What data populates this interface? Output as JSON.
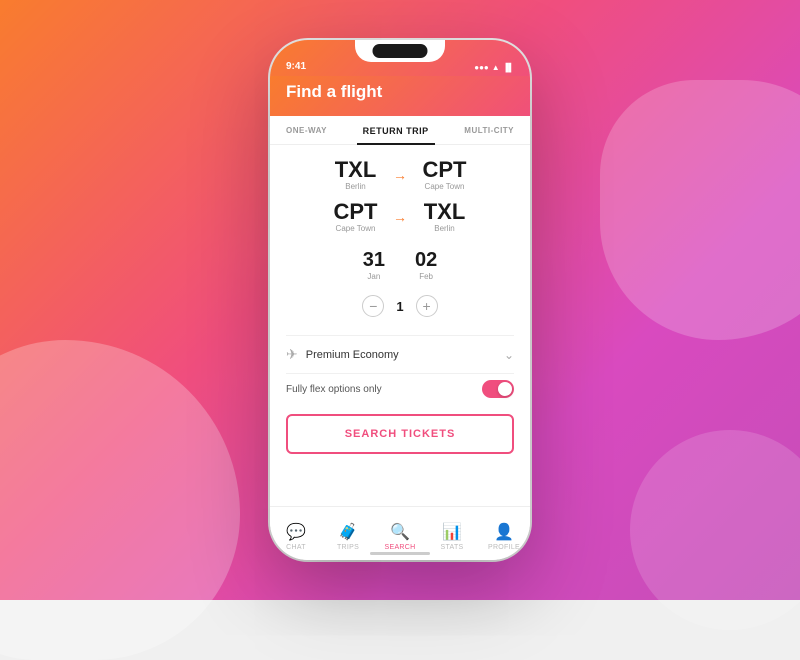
{
  "background": {
    "gradient_start": "#f97c2e",
    "gradient_end": "#c44db8"
  },
  "status_bar": {
    "time": "9:41",
    "signal": "▌▌▌",
    "wifi": "▲",
    "battery": "▐"
  },
  "header": {
    "title": "Find a flight"
  },
  "tabs": {
    "items": [
      {
        "label": "ONE-WAY",
        "active": false
      },
      {
        "label": "RETURN TRIP",
        "active": true
      },
      {
        "label": "MULTI-CITY",
        "active": false
      }
    ]
  },
  "routes": [
    {
      "from_code": "TXL",
      "from_city": "Berlin",
      "to_code": "CPT",
      "to_city": "Cape Town"
    },
    {
      "from_code": "CPT",
      "from_city": "Cape Town",
      "to_code": "TXL",
      "to_city": "Berlin"
    }
  ],
  "dates": {
    "depart_day": "31",
    "depart_month": "Jan",
    "return_day": "02",
    "return_month": "Feb"
  },
  "passengers": {
    "count": "1",
    "minus_label": "−",
    "plus_label": "+"
  },
  "class": {
    "label": "Premium Economy",
    "icon": "✈"
  },
  "flex": {
    "label": "Fully flex options only",
    "enabled": true
  },
  "search_button": {
    "label": "SEARCH TICKETS"
  },
  "bottom_nav": {
    "items": [
      {
        "label": "CHAT",
        "icon": "💬",
        "active": false
      },
      {
        "label": "TRIPS",
        "icon": "🧳",
        "active": false
      },
      {
        "label": "SEARCH",
        "icon": "🔍",
        "active": true
      },
      {
        "label": "STATS",
        "icon": "📊",
        "active": false
      },
      {
        "label": "PROFILE",
        "icon": "👤",
        "active": false
      }
    ]
  }
}
